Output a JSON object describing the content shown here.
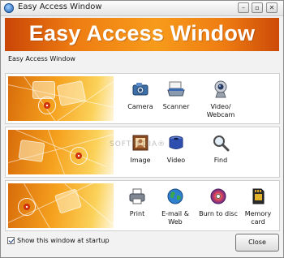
{
  "window": {
    "title": "Easy Access Window",
    "buttons": {
      "minimize": "–",
      "maximize": "▫",
      "close": "✕"
    }
  },
  "banner": {
    "title": "Easy Access Window"
  },
  "section_label": "Easy Access Window",
  "panels": [
    {
      "tools": [
        {
          "label": "Camera",
          "icon": "camera-icon"
        },
        {
          "label": "Scanner",
          "icon": "scanner-icon"
        },
        {
          "label": "Video/\nWebcam",
          "icon": "webcam-icon"
        }
      ]
    },
    {
      "tools": [
        {
          "label": "Image",
          "icon": "image-icon"
        },
        {
          "label": "Video",
          "icon": "video-icon"
        },
        {
          "label": "Find",
          "icon": "find-icon"
        }
      ]
    },
    {
      "tools": [
        {
          "label": "Print",
          "icon": "printer-icon"
        },
        {
          "label": "E-mail &\nWeb",
          "icon": "globe-icon"
        },
        {
          "label": "Burn to disc",
          "icon": "disc-icon"
        },
        {
          "label": "Memory\ncard",
          "icon": "memory-card-icon"
        }
      ]
    }
  ],
  "watermark": "SOFTPEDIA®",
  "footer": {
    "startup_label": "Show this window at startup",
    "startup_checked": true,
    "close_label": "Close"
  },
  "colors": {
    "banner_orange": "#f0851a",
    "banner_dark": "#c94606",
    "accent_blue": "#1f63b6"
  }
}
